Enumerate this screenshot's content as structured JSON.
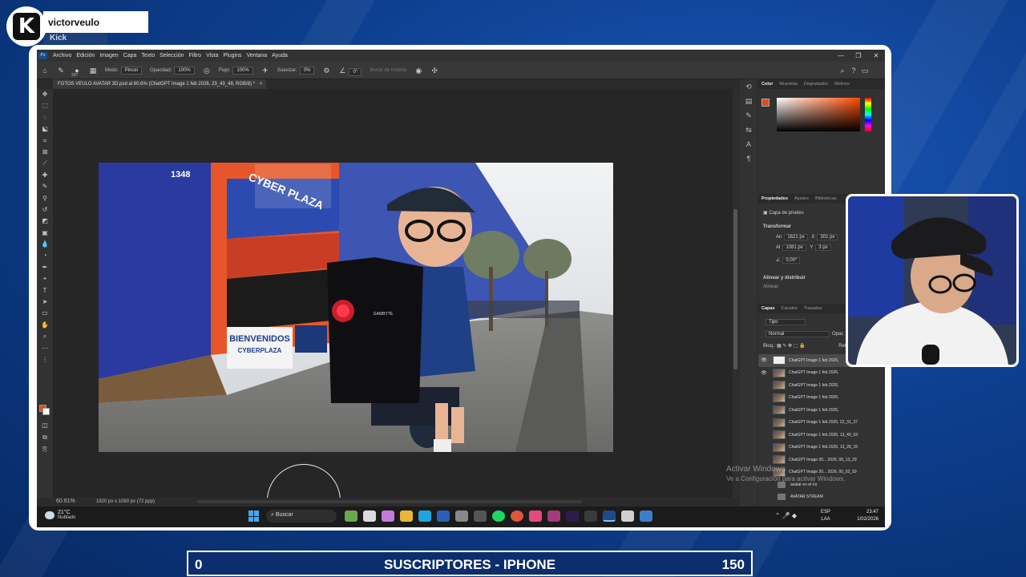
{
  "stream": {
    "username": "victorveulo",
    "platform": "Kick",
    "goal_current": "0",
    "goal_title": "SUSCRIPTORES - IPHONE",
    "goal_target": "150"
  },
  "photoshop": {
    "menu": [
      "Archivo",
      "Edición",
      "Imagen",
      "Capa",
      "Texto",
      "Selección",
      "Filtro",
      "Vista",
      "Plugins",
      "Ventana",
      "Ayuda"
    ],
    "options": {
      "brush_size": "337",
      "mode_label": "Modo:",
      "mode_value": "Pincel",
      "opacity_label": "Opacidad:",
      "opacity_value": "100%",
      "flow_label": "Flujo:",
      "flow_value": "100%",
      "smooth_label": "Suavizar:",
      "smooth_value": "0%",
      "angle_value": "0°",
      "erase_history": "Borrar de historia"
    },
    "document_tab": "FOTOS VEULO AVATAR 3D.psd al 60.6% (ChatGPT Image 1 feb 2026, 23_43_48, RGB/8) *",
    "zoom": "60.61%",
    "doc_size": "1920 px x 1080 px (72 ppp)",
    "color_tabs": [
      "Color",
      "Muestras",
      "Degradados",
      "Motivos"
    ],
    "prop_tabs": [
      "Propiedades",
      "Ajustes",
      "Bibliotecas"
    ],
    "properties": {
      "layer_type": "Capa de píxeles",
      "transform_title": "Transformar",
      "w_label": "An",
      "w_value": "1621 px",
      "h_label": "Al",
      "h_value": "1081 px",
      "x_label": "X",
      "x_value": "301 px",
      "y_label": "Y",
      "y_value": "3 px",
      "angle": "0,00°",
      "align_title": "Alinear y distribuir",
      "align_label": "Alinear:"
    },
    "layer_tabs": [
      "Capas",
      "Canales",
      "Trazados"
    ],
    "layer_filter": "Tipo",
    "blend_mode": "Normal",
    "opacity_short": "Opac",
    "lock_label": "Bloq.:",
    "fill_short": "Rell",
    "layers": [
      "ChatGPT Image 1 feb 2026,",
      "ChatGPT Image 1 feb 2026,",
      "ChatGPT Image 1 feb 2026,",
      "ChatGPT Image 1 feb 2026,",
      "ChatGPT Image 1 feb 2026,",
      "ChatGPT Image 1 feb 2026, 22_31_37",
      "ChatGPT Image 1 feb 2026, 13_40_03",
      "ChatGPT Image 1 feb 2026, 13_28_15",
      "ChatGPT Image 30... 2026, 00_13_29",
      "ChatGPT Image 30... 2026, 00_02_59"
    ],
    "groups": [
      "avatar en el río",
      "AVATAR STREAM"
    ],
    "activate_windows": "Activar Windows",
    "activate_windows_sub": "Ve a Configuración para activar Windows."
  },
  "photo": {
    "store_sign": "CYBER PLAZA",
    "store_number": "1348",
    "banner_title": "BIENVENIDOS",
    "banner_sub": "CYBERPLAZA",
    "pc_brand": "GAMBYTE"
  },
  "taskbar": {
    "temperature": "21°C",
    "weather": "Nublado",
    "search": "Buscar",
    "lang1": "ESP",
    "lang2": "LAA",
    "time": "23:47",
    "date": "1/02/2026"
  },
  "colors": {
    "accent_orange": "#e04b1a",
    "ps_dark": "#2b2b2b",
    "goal_blue": "#0c2e6e"
  }
}
